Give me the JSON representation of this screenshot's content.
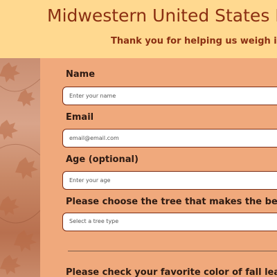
{
  "header": {
    "title": "Midwestern United States Fall",
    "subtitle": "Thank you for helping us weigh in on our reg"
  },
  "side_image": {
    "icon": "autumn-leaves-photo"
  },
  "form": {
    "name": {
      "label": "Name",
      "placeholder": "Enter your name"
    },
    "email": {
      "label": "Email",
      "placeholder": "email@email.com"
    },
    "age": {
      "label": "Age (optional)",
      "placeholder": "Enter your age"
    },
    "tree": {
      "label": "Please choose the tree that makes the best fall foilage:",
      "selected": "Select a tree type"
    },
    "colors": {
      "label": "Please check your favorite color of fall leaves (check all"
    }
  },
  "colors": {
    "header_bg": "#ffd990",
    "form_bg": "#f0a97c",
    "title": "#8a2f12",
    "border": "#7a2a12"
  }
}
